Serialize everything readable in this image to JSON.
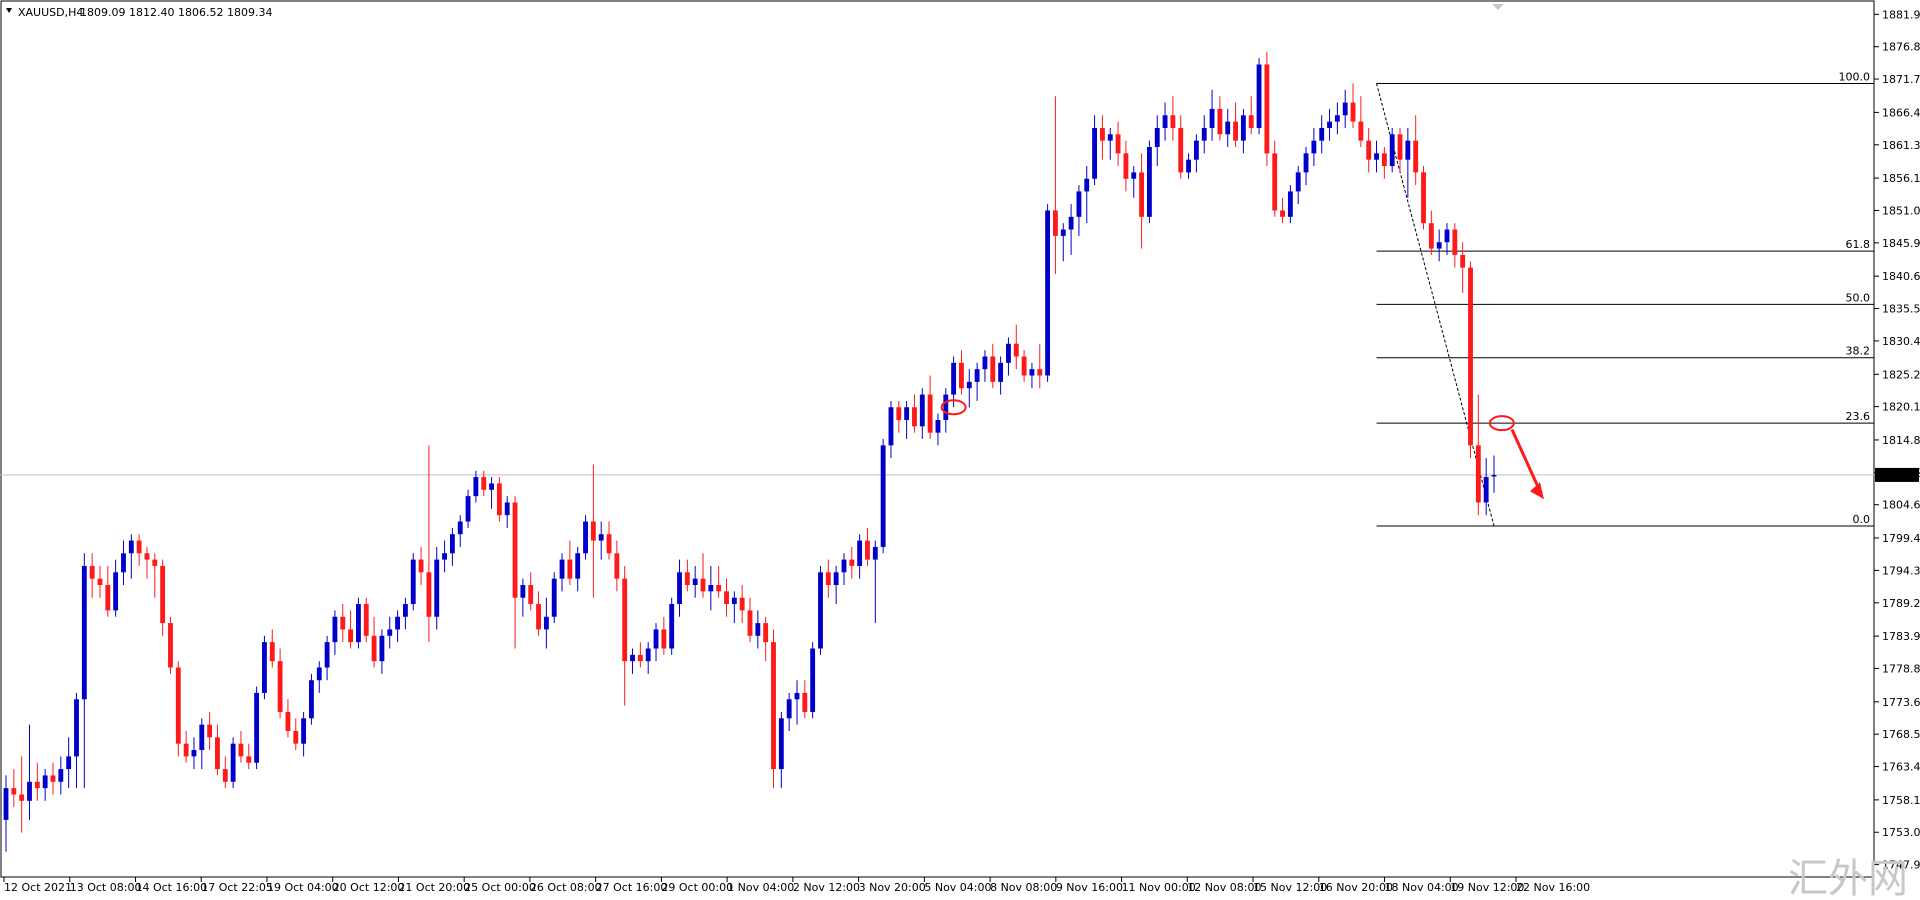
{
  "header": {
    "symbol_label": "XAUUSD,H4",
    "ohlc": "1809.09 1812.40 1806.52 1809.34"
  },
  "watermark": {
    "text": "汇外网"
  },
  "colors": {
    "bull": "#0000c8",
    "bear": "#ff1a1a",
    "grid": "#000000",
    "price_line": "#c0c0c0",
    "annotation": "#ff1a1a"
  },
  "chart_data": {
    "type": "candlestick",
    "symbol": "XAUUSD",
    "timeframe": "H4",
    "current_price": 1809.34,
    "ylim": [
      1746,
      1884
    ],
    "y_ticks": [
      1881.9,
      1876.8,
      1871.7,
      1866.45,
      1861.35,
      1856.1,
      1851.0,
      1845.9,
      1840.65,
      1835.55,
      1830.45,
      1825.2,
      1820.1,
      1814.85,
      1809.75,
      1804.65,
      1799.4,
      1794.3,
      1789.2,
      1783.95,
      1778.85,
      1773.6,
      1768.5,
      1763.4,
      1758.15,
      1753.05,
      1747.95
    ],
    "x_labels": [
      "12 Oct 2021",
      "13 Oct 08:00",
      "14 Oct 16:00",
      "17 Oct 22:05",
      "19 Oct 04:00",
      "20 Oct 12:00",
      "21 Oct 20:00",
      "25 Oct 00:00",
      "26 Oct 08:00",
      "27 Oct 16:00",
      "29 Oct 00:00",
      "1 Nov 04:00",
      "2 Nov 12:00",
      "3 Nov 20:00",
      "5 Nov 04:00",
      "8 Nov 08:00",
      "9 Nov 16:00",
      "11 Nov 00:00",
      "12 Nov 08:00",
      "15 Nov 12:00",
      "16 Nov 20:00",
      "18 Nov 04:00",
      "19 Nov 12:00",
      "22 Nov 16:00"
    ],
    "candles": [
      [
        1755,
        1762,
        1750,
        1760
      ],
      [
        1760,
        1763,
        1757,
        1759
      ],
      [
        1759,
        1765,
        1753,
        1758
      ],
      [
        1758,
        1770,
        1755,
        1761
      ],
      [
        1761,
        1764,
        1758,
        1760
      ],
      [
        1760,
        1763,
        1758,
        1762
      ],
      [
        1762,
        1764,
        1759,
        1761
      ],
      [
        1761,
        1765,
        1759,
        1763
      ],
      [
        1763,
        1768,
        1760,
        1765
      ],
      [
        1765,
        1775,
        1760,
        1774
      ],
      [
        1774,
        1797,
        1760,
        1795
      ],
      [
        1795,
        1797,
        1790,
        1793
      ],
      [
        1793,
        1795,
        1790,
        1792
      ],
      [
        1792,
        1795,
        1787,
        1788
      ],
      [
        1788,
        1796,
        1787,
        1794
      ],
      [
        1794,
        1799,
        1792,
        1797
      ],
      [
        1797,
        1800,
        1793,
        1799
      ],
      [
        1799,
        1800,
        1795,
        1797
      ],
      [
        1797,
        1798,
        1793,
        1796
      ],
      [
        1796,
        1797,
        1790,
        1795
      ],
      [
        1795,
        1796,
        1784,
        1786
      ],
      [
        1786,
        1787,
        1778,
        1779
      ],
      [
        1779,
        1780,
        1765,
        1767
      ],
      [
        1767,
        1769,
        1764,
        1765
      ],
      [
        1765,
        1768,
        1763,
        1766
      ],
      [
        1766,
        1771,
        1763,
        1770
      ],
      [
        1770,
        1772,
        1766,
        1768
      ],
      [
        1768,
        1770,
        1762,
        1763
      ],
      [
        1763,
        1765,
        1760,
        1761
      ],
      [
        1761,
        1768,
        1760,
        1767
      ],
      [
        1767,
        1769,
        1764,
        1765
      ],
      [
        1765,
        1767,
        1763,
        1764
      ],
      [
        1764,
        1776,
        1763,
        1775
      ],
      [
        1775,
        1784,
        1774,
        1783
      ],
      [
        1783,
        1785,
        1779,
        1780
      ],
      [
        1780,
        1782,
        1771,
        1772
      ],
      [
        1772,
        1774,
        1768,
        1769
      ],
      [
        1769,
        1771,
        1766,
        1767
      ],
      [
        1767,
        1772,
        1765,
        1771
      ],
      [
        1771,
        1778,
        1770,
        1777
      ],
      [
        1777,
        1780,
        1775,
        1779
      ],
      [
        1779,
        1784,
        1777,
        1783
      ],
      [
        1783,
        1788,
        1781,
        1787
      ],
      [
        1787,
        1789,
        1783,
        1785
      ],
      [
        1785,
        1788,
        1782,
        1783
      ],
      [
        1783,
        1790,
        1782,
        1789
      ],
      [
        1789,
        1790,
        1783,
        1784
      ],
      [
        1784,
        1787,
        1779,
        1780
      ],
      [
        1780,
        1785,
        1778,
        1784
      ],
      [
        1784,
        1787,
        1782,
        1785
      ],
      [
        1785,
        1788,
        1783,
        1787
      ],
      [
        1787,
        1790,
        1785,
        1789
      ],
      [
        1789,
        1797,
        1788,
        1796
      ],
      [
        1796,
        1798,
        1792,
        1794
      ],
      [
        1794,
        1814,
        1783,
        1787
      ],
      [
        1787,
        1798,
        1785,
        1796
      ],
      [
        1796,
        1799,
        1794,
        1797
      ],
      [
        1797,
        1801,
        1795,
        1800
      ],
      [
        1800,
        1803,
        1798,
        1802
      ],
      [
        1802,
        1807,
        1801,
        1806
      ],
      [
        1806,
        1810,
        1805,
        1809
      ],
      [
        1809,
        1810,
        1806,
        1807
      ],
      [
        1807,
        1809,
        1804,
        1808
      ],
      [
        1808,
        1809,
        1802,
        1803
      ],
      [
        1803,
        1806,
        1801,
        1805
      ],
      [
        1805,
        1806,
        1782,
        1790
      ],
      [
        1790,
        1793,
        1787,
        1792
      ],
      [
        1792,
        1794,
        1788,
        1789
      ],
      [
        1789,
        1791,
        1784,
        1785
      ],
      [
        1785,
        1790,
        1782,
        1787
      ],
      [
        1787,
        1794,
        1786,
        1793
      ],
      [
        1793,
        1797,
        1791,
        1796
      ],
      [
        1796,
        1799,
        1792,
        1793
      ],
      [
        1793,
        1798,
        1791,
        1797
      ],
      [
        1797,
        1803,
        1796,
        1802
      ],
      [
        1802,
        1811,
        1790,
        1799
      ],
      [
        1799,
        1802,
        1796,
        1800
      ],
      [
        1800,
        1802,
        1796,
        1797
      ],
      [
        1797,
        1799,
        1791,
        1793
      ],
      [
        1793,
        1795,
        1773,
        1780
      ],
      [
        1780,
        1782,
        1778,
        1781
      ],
      [
        1781,
        1783,
        1779,
        1780
      ],
      [
        1780,
        1783,
        1778,
        1782
      ],
      [
        1782,
        1786,
        1780,
        1785
      ],
      [
        1785,
        1787,
        1781,
        1782
      ],
      [
        1782,
        1790,
        1781,
        1789
      ],
      [
        1789,
        1796,
        1787,
        1794
      ],
      [
        1794,
        1796,
        1791,
        1792
      ],
      [
        1792,
        1795,
        1790,
        1793
      ],
      [
        1793,
        1797,
        1790,
        1791
      ],
      [
        1791,
        1795,
        1788,
        1792
      ],
      [
        1792,
        1795,
        1790,
        1791
      ],
      [
        1791,
        1793,
        1787,
        1789
      ],
      [
        1789,
        1791,
        1786,
        1790
      ],
      [
        1790,
        1792,
        1786,
        1788
      ],
      [
        1788,
        1790,
        1783,
        1784
      ],
      [
        1784,
        1788,
        1782,
        1786
      ],
      [
        1786,
        1787,
        1780,
        1783
      ],
      [
        1783,
        1785,
        1760,
        1763
      ],
      [
        1763,
        1772,
        1760,
        1771
      ],
      [
        1771,
        1775,
        1769,
        1774
      ],
      [
        1774,
        1777,
        1770,
        1775
      ],
      [
        1775,
        1777,
        1771,
        1772
      ],
      [
        1772,
        1783,
        1771,
        1782
      ],
      [
        1782,
        1795,
        1781,
        1794
      ],
      [
        1794,
        1796,
        1790,
        1792
      ],
      [
        1792,
        1795,
        1789,
        1794
      ],
      [
        1794,
        1797,
        1792,
        1796
      ],
      [
        1796,
        1798,
        1793,
        1795
      ],
      [
        1795,
        1800,
        1793,
        1799
      ],
      [
        1799,
        1801,
        1795,
        1796
      ],
      [
        1796,
        1799,
        1786,
        1798
      ],
      [
        1798,
        1815,
        1797,
        1814
      ],
      [
        1814,
        1821,
        1812,
        1820
      ],
      [
        1820,
        1821,
        1816,
        1818
      ],
      [
        1818,
        1821,
        1815,
        1820
      ],
      [
        1820,
        1822,
        1816,
        1817
      ],
      [
        1817,
        1823,
        1815,
        1822
      ],
      [
        1822,
        1825,
        1815,
        1816
      ],
      [
        1816,
        1819,
        1814,
        1818
      ],
      [
        1818,
        1823,
        1816,
        1822
      ],
      [
        1822,
        1828,
        1820,
        1827
      ],
      [
        1827,
        1829,
        1822,
        1823
      ],
      [
        1823,
        1826,
        1820,
        1824
      ],
      [
        1824,
        1827,
        1821,
        1826
      ],
      [
        1826,
        1829,
        1824,
        1828
      ],
      [
        1828,
        1830,
        1823,
        1824
      ],
      [
        1824,
        1828,
        1822,
        1827
      ],
      [
        1827,
        1831,
        1825,
        1830
      ],
      [
        1830,
        1833,
        1826,
        1828
      ],
      [
        1828,
        1829,
        1824,
        1825
      ],
      [
        1825,
        1827,
        1823,
        1826
      ],
      [
        1826,
        1830,
        1823,
        1825
      ],
      [
        1825,
        1852,
        1824,
        1851
      ],
      [
        1851,
        1869,
        1841,
        1847
      ],
      [
        1847,
        1849,
        1843,
        1848
      ],
      [
        1848,
        1852,
        1844,
        1850
      ],
      [
        1850,
        1855,
        1847,
        1854
      ],
      [
        1854,
        1858,
        1849,
        1856
      ],
      [
        1856,
        1866,
        1855,
        1864
      ],
      [
        1864,
        1866,
        1859,
        1862
      ],
      [
        1862,
        1864,
        1859,
        1863
      ],
      [
        1863,
        1865,
        1858,
        1860
      ],
      [
        1860,
        1862,
        1854,
        1856
      ],
      [
        1856,
        1858,
        1853,
        1857
      ],
      [
        1857,
        1860,
        1845,
        1850
      ],
      [
        1850,
        1862,
        1849,
        1861
      ],
      [
        1861,
        1866,
        1858,
        1864
      ],
      [
        1864,
        1868,
        1862,
        1866
      ],
      [
        1866,
        1869,
        1862,
        1864
      ],
      [
        1864,
        1866,
        1856,
        1857
      ],
      [
        1857,
        1860,
        1856,
        1859
      ],
      [
        1859,
        1863,
        1857,
        1862
      ],
      [
        1862,
        1866,
        1860,
        1864
      ],
      [
        1864,
        1870,
        1862,
        1867
      ],
      [
        1867,
        1869,
        1862,
        1863
      ],
      [
        1863,
        1867,
        1861,
        1865
      ],
      [
        1865,
        1868,
        1861,
        1862
      ],
      [
        1862,
        1867,
        1860,
        1866
      ],
      [
        1866,
        1869,
        1863,
        1864
      ],
      [
        1864,
        1875,
        1863,
        1874
      ],
      [
        1874,
        1876,
        1858,
        1860
      ],
      [
        1860,
        1862,
        1850,
        1851
      ],
      [
        1851,
        1853,
        1849,
        1850
      ],
      [
        1850,
        1855,
        1849,
        1854
      ],
      [
        1854,
        1858,
        1852,
        1857
      ],
      [
        1857,
        1861,
        1855,
        1860
      ],
      [
        1860,
        1864,
        1858,
        1862
      ],
      [
        1862,
        1866,
        1860,
        1864
      ],
      [
        1864,
        1867,
        1862,
        1865
      ],
      [
        1865,
        1868,
        1863,
        1866
      ],
      [
        1866,
        1870,
        1864,
        1868
      ],
      [
        1868,
        1871,
        1864,
        1865
      ],
      [
        1865,
        1869,
        1861,
        1862
      ],
      [
        1862,
        1864,
        1857,
        1859
      ],
      [
        1859,
        1862,
        1857,
        1860
      ],
      [
        1860,
        1861,
        1856,
        1858
      ],
      [
        1858,
        1864,
        1857,
        1863
      ],
      [
        1863,
        1864,
        1857,
        1859
      ],
      [
        1859,
        1864,
        1853,
        1862
      ],
      [
        1862,
        1866,
        1855,
        1857
      ],
      [
        1857,
        1858,
        1848,
        1849
      ],
      [
        1849,
        1851,
        1844,
        1845
      ],
      [
        1845,
        1848,
        1843,
        1846
      ],
      [
        1846,
        1849,
        1844,
        1848
      ],
      [
        1848,
        1849,
        1842,
        1844
      ],
      [
        1844,
        1846,
        1838,
        1842
      ],
      [
        1842,
        1843,
        1812,
        1814
      ],
      [
        1814,
        1822,
        1803,
        1805
      ],
      [
        1805,
        1812,
        1803,
        1809
      ],
      [
        1809.09,
        1812.4,
        1806.52,
        1809.34
      ]
    ],
    "fibonacci": {
      "levels": [
        {
          "label": "100.0",
          "price": 1871.0
        },
        {
          "label": "61.8",
          "price": 1844.6
        },
        {
          "label": "50.0",
          "price": 1836.2
        },
        {
          "label": "38.2",
          "price": 1827.8
        },
        {
          "label": "23.6",
          "price": 1817.5
        },
        {
          "label": "0.0",
          "price": 1801.3
        }
      ]
    },
    "annotations": [
      {
        "type": "ellipse",
        "candle_index": 121,
        "price": 1820
      },
      {
        "type": "ellipse",
        "candle_index": 191,
        "price": 1817.5
      },
      {
        "type": "arrow",
        "direction": "down"
      }
    ]
  }
}
